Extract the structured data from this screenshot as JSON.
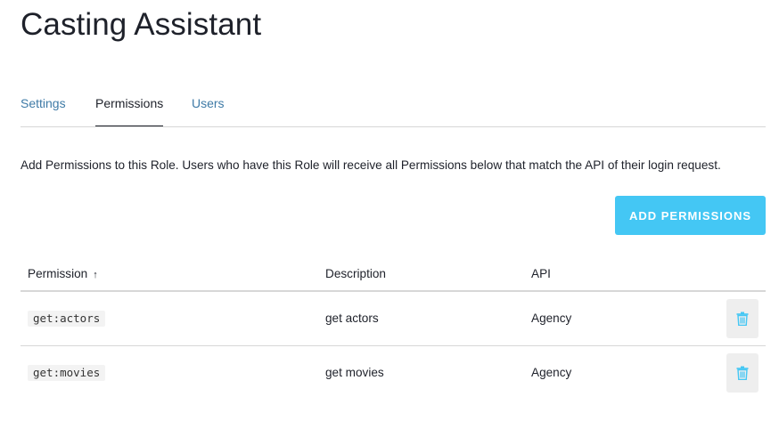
{
  "page": {
    "title": "Casting Assistant"
  },
  "tabs": [
    {
      "label": "Settings",
      "active": false
    },
    {
      "label": "Permissions",
      "active": true
    },
    {
      "label": "Users",
      "active": false
    }
  ],
  "info_text": "Add Permissions to this Role. Users who have this Role will receive all Permissions below that match the API of their login request.",
  "add_button": {
    "label": "ADD PERMISSIONS",
    "color": "#44c7f4"
  },
  "table": {
    "headers": {
      "permission": "Permission",
      "sort_indicator": "↑",
      "description": "Description",
      "api": "API"
    },
    "rows": [
      {
        "permission": "get:actors",
        "description": "get actors",
        "api": "Agency",
        "action_icon": "trash-icon"
      },
      {
        "permission": "get:movies",
        "description": "get movies",
        "api": "Agency",
        "action_icon": "trash-icon"
      }
    ]
  },
  "colors": {
    "link": "#3e7aa6",
    "text": "#1e212a",
    "divider": "#d7d7d7",
    "trash_icon": "#44c7f4"
  }
}
